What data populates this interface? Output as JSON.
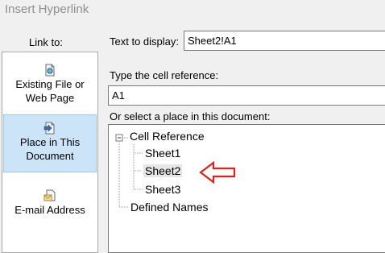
{
  "dialog": {
    "title": "Insert Hyperlink"
  },
  "link_to": {
    "label": "Link to:",
    "items": [
      {
        "line1": "Existing File or",
        "line2": "Web Page",
        "icon": "web-page-icon",
        "selected": false
      },
      {
        "line1": "Place in This",
        "line2": "Document",
        "icon": "place-in-document-icon",
        "selected": true
      },
      {
        "line1": "E-mail Address",
        "line2": "",
        "icon": "email-address-icon",
        "selected": false
      }
    ]
  },
  "text_to_display": {
    "label": "Text to display:",
    "value": "Sheet2!A1"
  },
  "cell_reference": {
    "label": "Type the cell reference:",
    "value": "A1"
  },
  "place": {
    "label": "Or select a place in this document:",
    "tree": {
      "root": "Cell Reference",
      "children": [
        "Sheet1",
        "Sheet2",
        "Sheet3"
      ],
      "selected": "Sheet2",
      "defined_names": "Defined Names"
    }
  },
  "colors": {
    "selection": "#cce4f7",
    "annotation": "#e0201b"
  }
}
